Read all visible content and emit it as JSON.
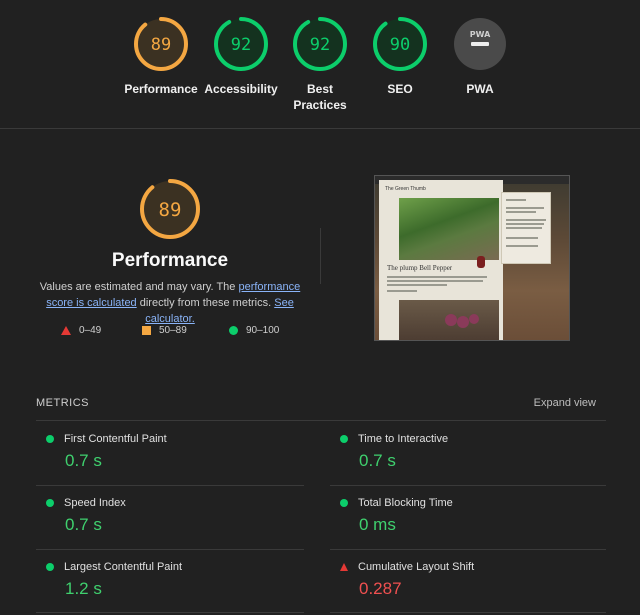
{
  "scores": [
    {
      "label": "Performance",
      "value": "89",
      "score": 0.89,
      "color": "#f4a742"
    },
    {
      "label": "Accessibility",
      "value": "92",
      "score": 0.92,
      "color": "#0cce6b"
    },
    {
      "label": "Best Practices",
      "value": "92",
      "score": 0.92,
      "color": "#0cce6b"
    },
    {
      "label": "SEO",
      "value": "90",
      "score": 0.9,
      "color": "#0cce6b"
    },
    {
      "label": "PWA",
      "value": "PWA",
      "score": null,
      "color": "#9e9e9e"
    }
  ],
  "performance": {
    "score": "89",
    "title": "Performance",
    "desc_part1": "Values are estimated and may vary. The ",
    "desc_link1": "performance score is calculated",
    "desc_part2": " directly from these metrics. ",
    "desc_link2": "See calculator."
  },
  "legend": {
    "fail": "0–49",
    "average": "50–89",
    "pass": "90–100"
  },
  "metrics": {
    "header": "METRICS",
    "expand": "Expand view",
    "items": [
      {
        "label": "First Contentful Paint",
        "value": "0.7 s",
        "status": "pass"
      },
      {
        "label": "Time to Interactive",
        "value": "0.7 s",
        "status": "pass"
      },
      {
        "label": "Speed Index",
        "value": "0.7 s",
        "status": "pass"
      },
      {
        "label": "Total Blocking Time",
        "value": "0 ms",
        "status": "pass"
      },
      {
        "label": "Largest Contentful Paint",
        "value": "1.2 s",
        "status": "pass"
      },
      {
        "label": "Cumulative Layout Shift",
        "value": "0.287",
        "status": "fail"
      }
    ]
  },
  "thumbnail": {
    "site_title": "The Green Thumb",
    "post_title": "The plump Bell Pepper"
  }
}
